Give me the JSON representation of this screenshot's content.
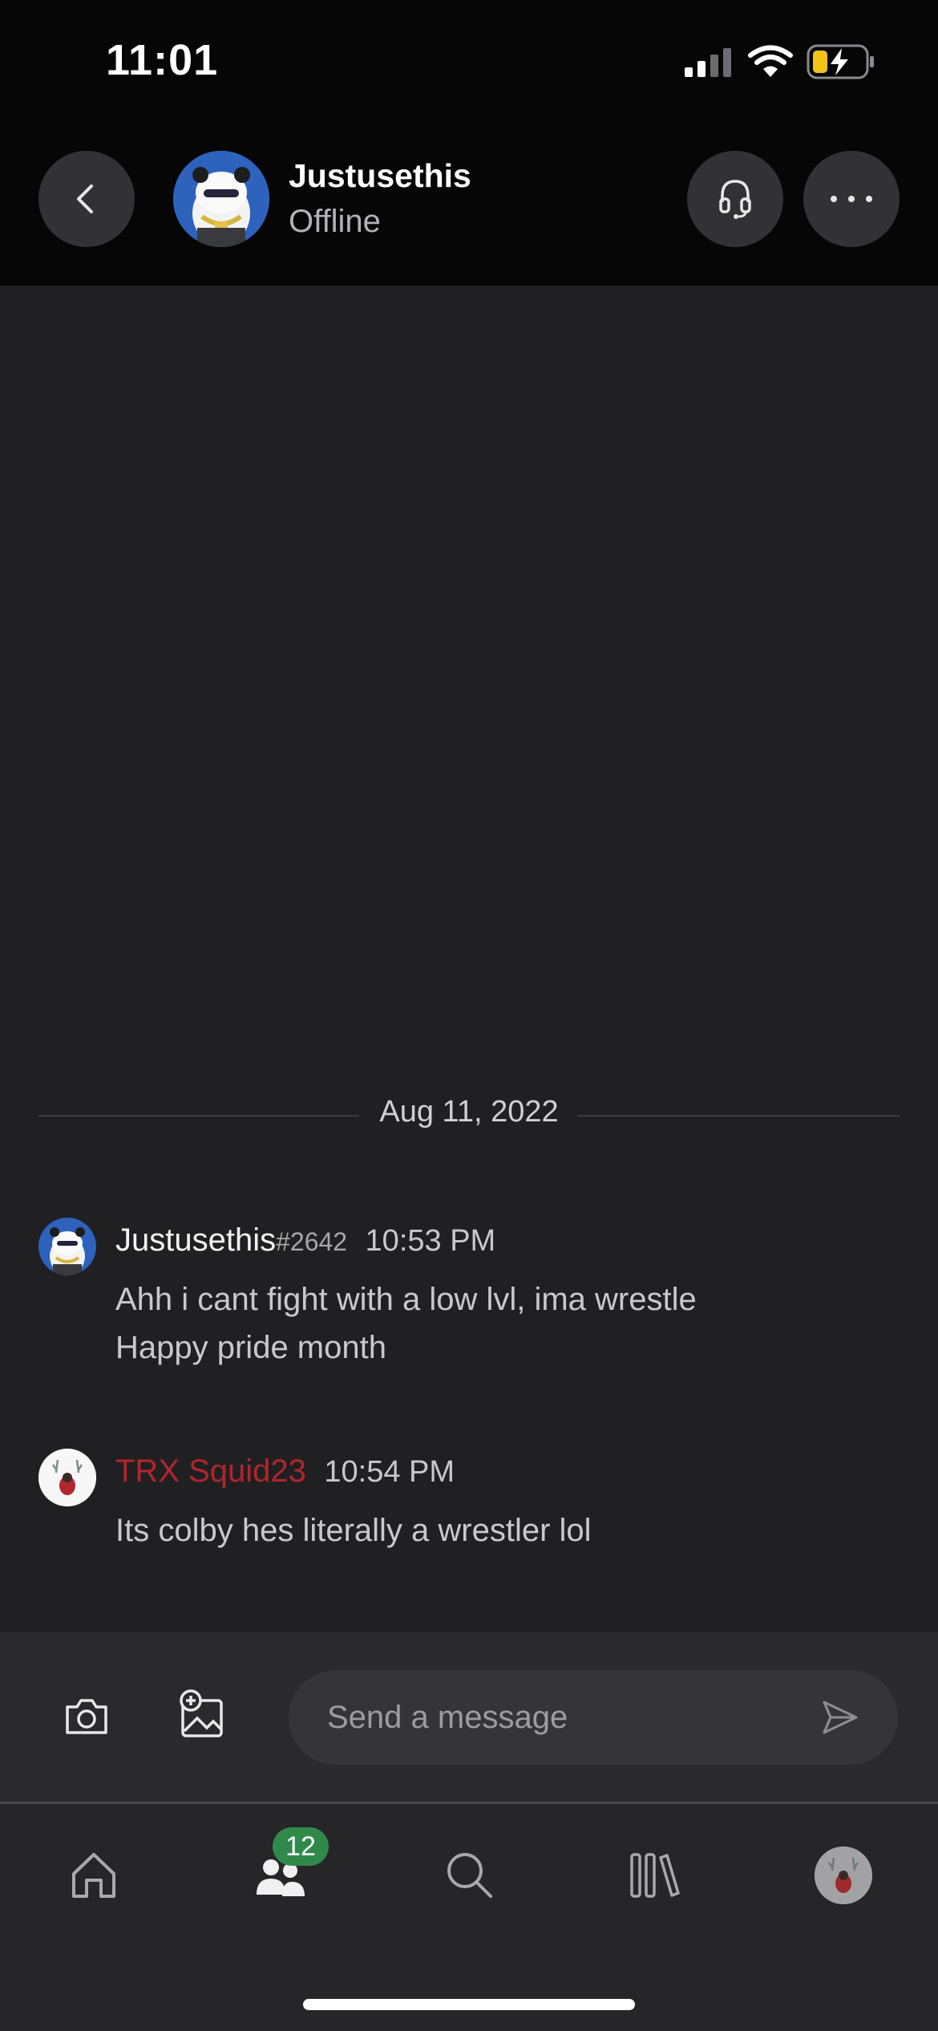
{
  "status_bar": {
    "time": "11:01"
  },
  "header": {
    "contact_name": "Justusethis",
    "contact_status": "Offline",
    "icons": [
      "back-icon",
      "headset-icon",
      "more-icon"
    ]
  },
  "chat": {
    "date_divider": "Aug 11, 2022",
    "messages": [
      {
        "author": "Justusethis",
        "tag": "#2642",
        "time": "10:53 PM",
        "lines": [
          "Ahh i cant fight with a low lvl, ima wrestle",
          "Happy pride month"
        ]
      },
      {
        "author": "TRX Squid23",
        "author_color": "#b0262c",
        "time": "10:54 PM",
        "lines": [
          "Its colby hes literally a wrestler lol"
        ]
      }
    ]
  },
  "composer": {
    "placeholder": "Send a message",
    "icons": [
      "camera-icon",
      "add-image-icon",
      "send-icon"
    ]
  },
  "tabbar": {
    "tabs": [
      "home-icon",
      "friends-icon",
      "search-icon",
      "library-icon",
      "profile-avatar"
    ],
    "friends_badge": "12",
    "badge_color": "#2f8a4a"
  }
}
